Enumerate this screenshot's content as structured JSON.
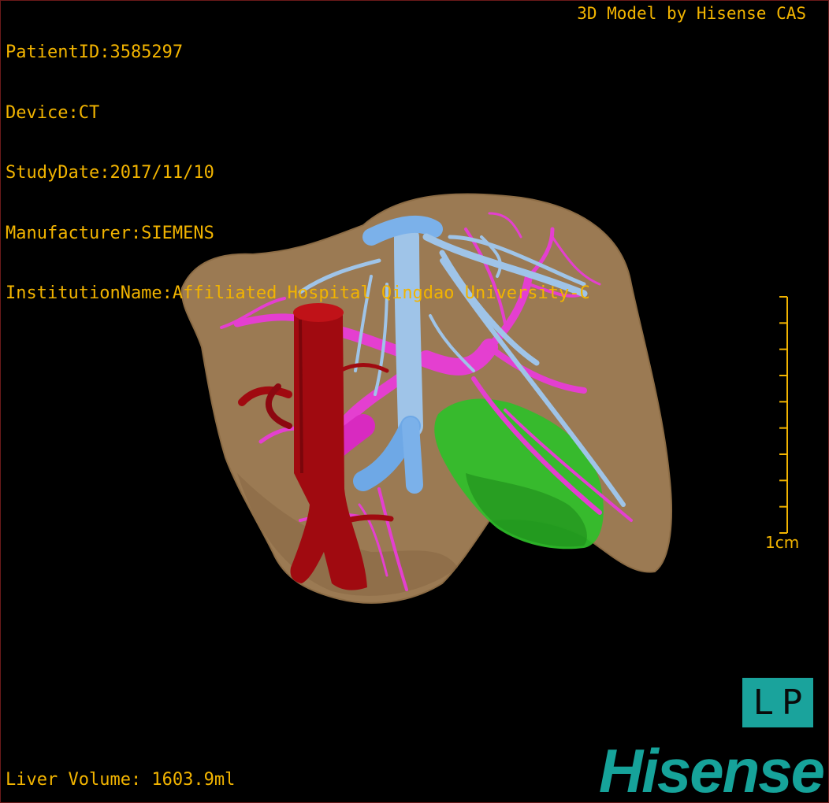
{
  "overlay": {
    "patient_id": "PatientID:3585297",
    "device": "Device:CT",
    "study_date": "StudyDate:2017/11/10",
    "manufacturer": "Manufacturer:SIEMENS",
    "institution": "InstitutionName:Affiliated Hospital Qingdao University-C",
    "model_credit": "3D Model by Hisense CAS",
    "liver_volume": "Liver Volume: 1603.9ml"
  },
  "scale_bar": {
    "label": "1cm",
    "ticks": 9
  },
  "orientation": {
    "left": "L",
    "right": "P"
  },
  "brand": {
    "logo": "Hisense"
  },
  "colors": {
    "text": "#f2b400",
    "liver": "#a8845a",
    "hepatic_vein": "#9fc4e8",
    "portal_vein": "#e43fd0",
    "ivc": "#a00a10",
    "gallbladder": "#2fbf2a",
    "brand": "#16a39a"
  }
}
